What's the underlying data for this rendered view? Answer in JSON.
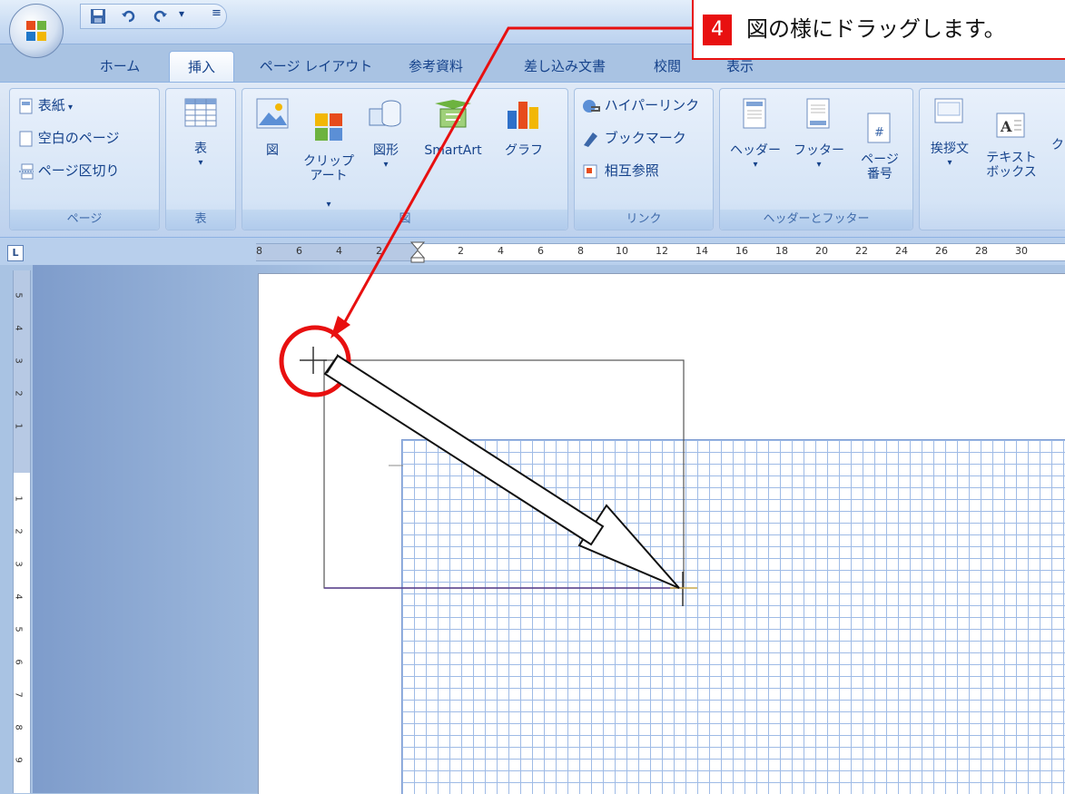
{
  "tabs": [
    "ホーム",
    "挿入",
    "ページ レイアウト",
    "参考資料",
    "差し込み文書",
    "校閲",
    "表示"
  ],
  "ribbon": {
    "page_group": {
      "items": [
        "表紙",
        "空白のページ",
        "ページ区切り"
      ],
      "label": "ページ"
    },
    "table_group": {
      "button": "表",
      "label": "表"
    },
    "illustration_group": {
      "buttons": [
        "図",
        "クリップ\nアート",
        "図形",
        "SmartArt",
        "グラフ"
      ],
      "label": "図"
    },
    "link_group": {
      "items": [
        "ハイパーリンク",
        "ブックマーク",
        "相互参照"
      ],
      "label": "リンク"
    },
    "header_footer_group": {
      "buttons": [
        "ヘッダー",
        "フッター",
        "ページ\n番号"
      ],
      "label": "ヘッダーとフッター"
    },
    "text_group": {
      "buttons": [
        "挨拶文",
        "テキスト\nボックス",
        "ク"
      ]
    }
  },
  "ruler": {
    "h_numbers": [
      "8",
      "6",
      "4",
      "2",
      "2",
      "4",
      "6",
      "8",
      "10",
      "12",
      "14",
      "16",
      "18",
      "20",
      "22",
      "24",
      "26",
      "28",
      "30"
    ],
    "v_numbers": [
      "5",
      "4",
      "3",
      "2",
      "1",
      "1",
      "2",
      "3",
      "4",
      "5",
      "6",
      "7",
      "8",
      "9"
    ]
  },
  "callout": {
    "number": "4",
    "text": "図の様にドラッグします。"
  },
  "colors": {
    "annotation_red": "#e81010",
    "grid_line": "#9fbbe6",
    "ribbon_text": "#15428b"
  }
}
